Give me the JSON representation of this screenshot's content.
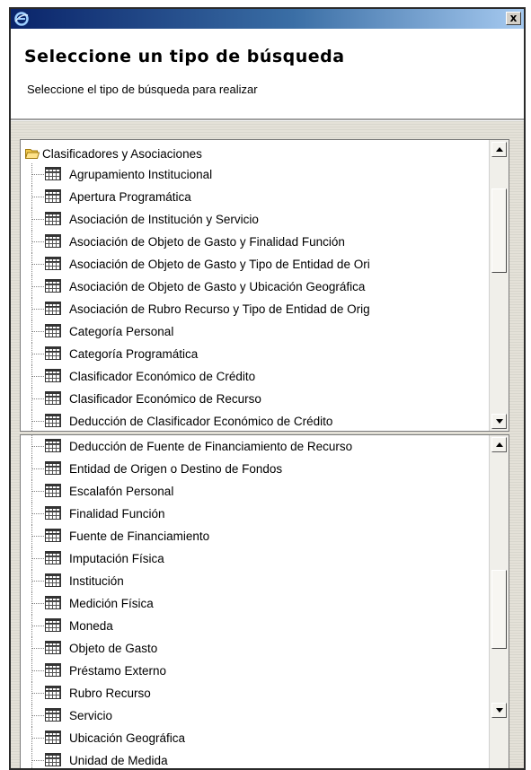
{
  "window": {
    "header_title": "Seleccione un tipo de búsqueda",
    "header_subtitle": "Seleccione el tipo de búsqueda para realizar",
    "close_label": "x"
  },
  "tree": {
    "root_label": "Clasificadores y Asociaciones",
    "items": [
      "Agrupamiento Institucional",
      "Apertura Programática",
      "Asociación de Institución y Servicio",
      "Asociación de Objeto de Gasto y Finalidad Función",
      "Asociación de Objeto de Gasto y Tipo de Entidad de Ori",
      "Asociación de Objeto de Gasto y Ubicación Geográfica",
      "Asociación de Rubro Recurso y Tipo de Entidad de Orig",
      "Categoría Personal",
      "Categoría Programática",
      "Clasificador Económico de Crédito",
      "Clasificador Económico de Recurso",
      "Deducción de Clasificador Económico de Crédito"
    ],
    "items_scrolled": [
      "Deducción de Fuente de Financiamiento de Recurso",
      "Entidad de Origen o Destino de Fondos",
      "Escalafón Personal",
      "Finalidad Función",
      "Fuente de Financiamiento",
      "Imputación Física",
      "Institución",
      "Medición Física",
      "Moneda",
      "Objeto de Gasto",
      "Préstamo Externo",
      "Rubro Recurso",
      "Servicio",
      "Ubicación Geográfica",
      "Unidad de Medida"
    ]
  },
  "icons": {
    "app": "ie-icon",
    "folder": "folder-open-icon",
    "item": "table-icon"
  },
  "colors": {
    "titlebar_dark": "#0a246a",
    "titlebar_light": "#a6caf0",
    "folder": "#f2c94c"
  }
}
